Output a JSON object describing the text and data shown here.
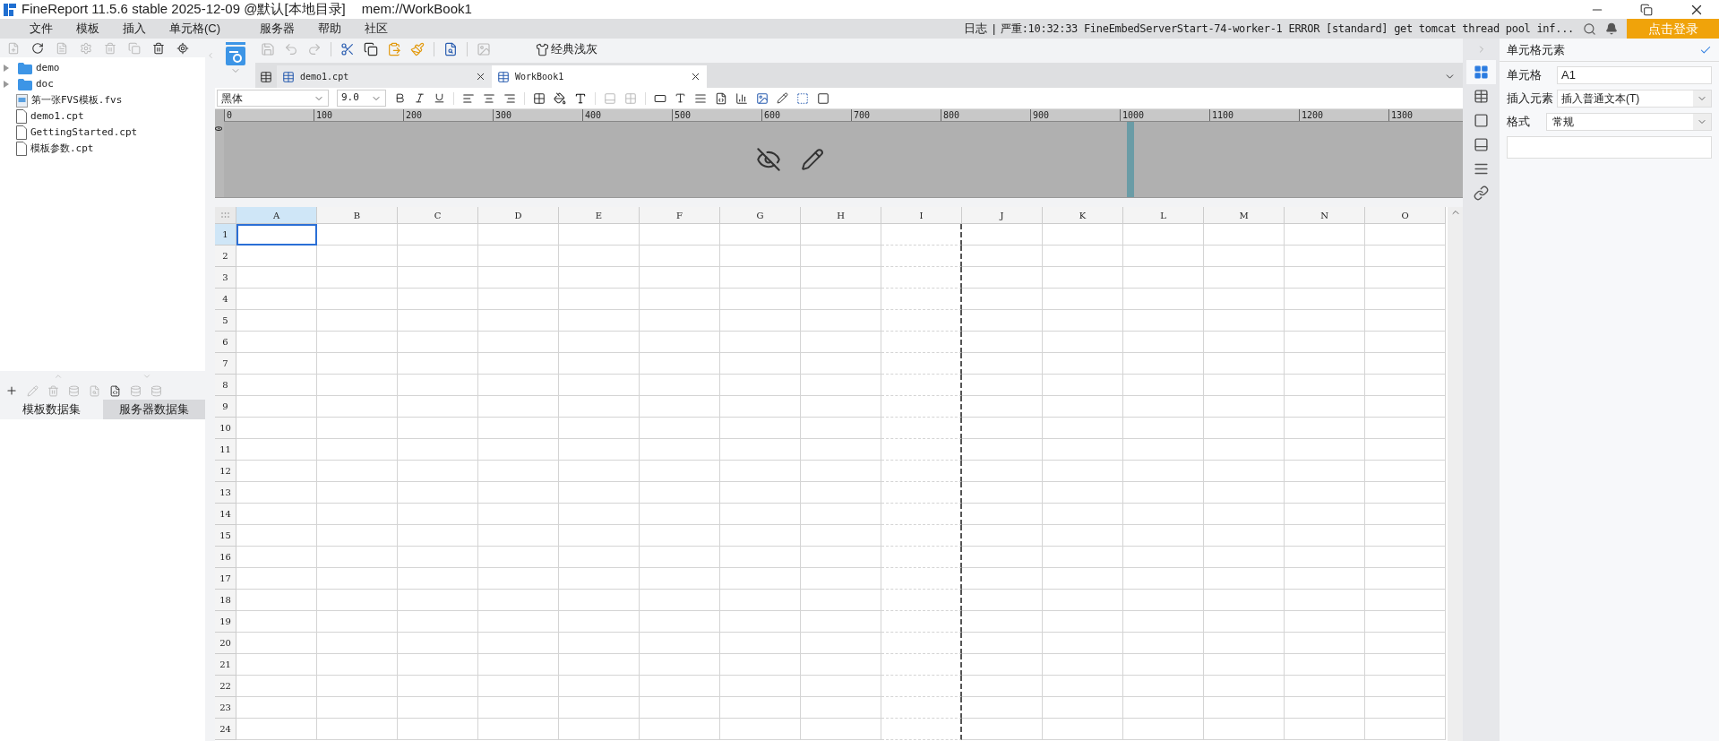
{
  "window": {
    "title": "FineReport 11.5.6 stable 2025-12-09 @默认[本地目录]",
    "path": "mem://WorkBook1"
  },
  "menu": [
    "文件",
    "模板",
    "插入",
    "单元格(C)",
    "服务器",
    "帮助",
    "社区"
  ],
  "log": {
    "label": "日志",
    "separator": "|",
    "message": "严重:10:32:33 FineEmbedServerStart-74-worker-1 ERROR [standard] get tomcat thread pool inf..."
  },
  "login_button": "点击登录",
  "file_tree": [
    {
      "kind": "folder",
      "name": "demo"
    },
    {
      "kind": "folder",
      "name": "doc"
    },
    {
      "kind": "fvs",
      "name": "第一张FVS模板.fvs"
    },
    {
      "kind": "cpt",
      "name": "demo1.cpt"
    },
    {
      "kind": "cpt",
      "name": "GettingStarted.cpt"
    },
    {
      "kind": "cpt",
      "name": "模板参数.cpt"
    }
  ],
  "dataset_tabs": [
    {
      "label": "模板数据集",
      "selected": true
    },
    {
      "label": "服务器数据集",
      "selected": false
    }
  ],
  "theme_button": "经典浅灰",
  "doc_tabs": [
    {
      "label": "demo1.cpt",
      "selected": false
    },
    {
      "label": "WorkBook1",
      "selected": true
    }
  ],
  "font": {
    "family": "黑体",
    "size": "9.0"
  },
  "ruler": {
    "vertical": "0",
    "labels": [
      "0",
      "100",
      "200",
      "300",
      "400",
      "500",
      "600",
      "700",
      "800",
      "900",
      "1000",
      "1100",
      "1200",
      "1300"
    ]
  },
  "grid": {
    "columns": [
      {
        "label": "A",
        "selected": true
      },
      {
        "label": "B",
        "selected": false
      },
      {
        "label": "C",
        "selected": false
      },
      {
        "label": "D",
        "selected": false
      },
      {
        "label": "E",
        "selected": false
      },
      {
        "label": "F",
        "selected": false
      },
      {
        "label": "G",
        "selected": false
      },
      {
        "label": "H",
        "selected": false
      },
      {
        "label": "I",
        "selected": false
      },
      {
        "label": "J",
        "selected": false
      },
      {
        "label": "K",
        "selected": false
      },
      {
        "label": "L",
        "selected": false
      },
      {
        "label": "M",
        "selected": false
      },
      {
        "label": "N",
        "selected": false
      },
      {
        "label": "O",
        "selected": false
      }
    ],
    "rows": [
      {
        "label": "1",
        "selected": true
      },
      {
        "label": "2",
        "selected": false
      },
      {
        "label": "3",
        "selected": false
      },
      {
        "label": "4",
        "selected": false
      },
      {
        "label": "5",
        "selected": false
      },
      {
        "label": "6",
        "selected": false
      },
      {
        "label": "7",
        "selected": false
      },
      {
        "label": "8",
        "selected": false
      },
      {
        "label": "9",
        "selected": false
      },
      {
        "label": "10",
        "selected": false
      },
      {
        "label": "11",
        "selected": false
      },
      {
        "label": "12",
        "selected": false
      },
      {
        "label": "13",
        "selected": false
      },
      {
        "label": "14",
        "selected": false
      },
      {
        "label": "15",
        "selected": false
      },
      {
        "label": "16",
        "selected": false
      },
      {
        "label": "17",
        "selected": false
      },
      {
        "label": "18",
        "selected": false
      },
      {
        "label": "19",
        "selected": false
      },
      {
        "label": "20",
        "selected": false
      },
      {
        "label": "21",
        "selected": false
      },
      {
        "label": "22",
        "selected": false
      },
      {
        "label": "23",
        "selected": false
      },
      {
        "label": "24",
        "selected": false
      }
    ]
  },
  "side_tabs": [
    {
      "selected": true
    },
    {
      "selected": false
    },
    {
      "selected": false
    },
    {
      "selected": false
    },
    {
      "selected": false
    },
    {
      "selected": false
    }
  ],
  "properties": {
    "title": "单元格元素",
    "cell": {
      "label": "单元格",
      "value": "A1"
    },
    "insert": {
      "label": "插入元素",
      "value": "插入普通文本(T)"
    },
    "format": {
      "label": "格式",
      "value": "常规"
    }
  }
}
